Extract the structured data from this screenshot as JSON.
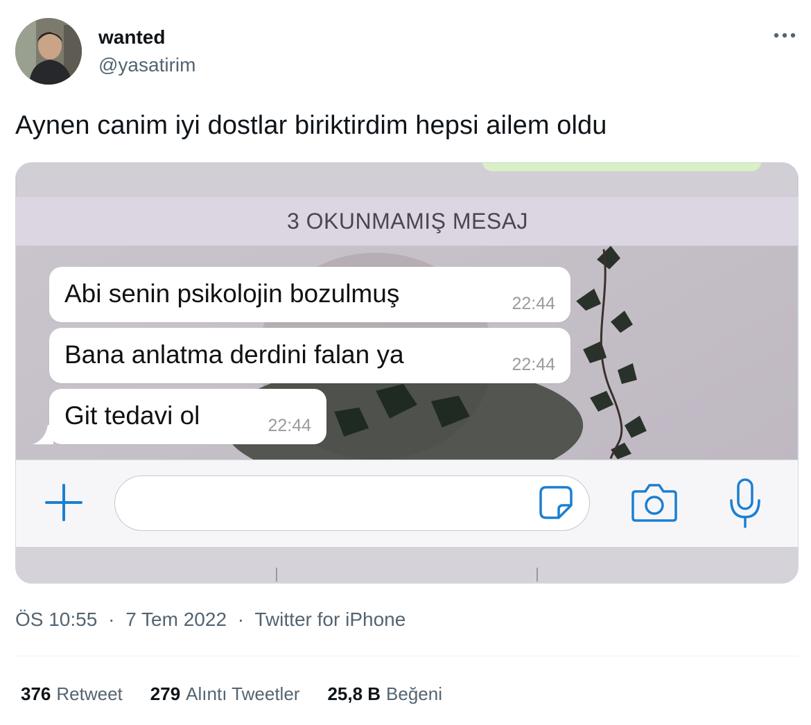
{
  "tweet": {
    "author_name": "wanted",
    "author_handle": "@yasatirim",
    "text": "Aynen canim iyi dostlar biriktirdim hepsi ailem oldu",
    "time": "ÖS 10:55",
    "date": "7 Tem 2022",
    "source": "Twitter for iPhone",
    "separator": "·",
    "more_icon": "more-horizontal-icon"
  },
  "chat": {
    "unread_label": "3 OKUNMAMIŞ MESAJ",
    "messages": [
      {
        "text": "Abi senin psikolojin bozulmuş",
        "time": "22:44"
      },
      {
        "text": "Bana anlatma derdini falan ya",
        "time": "22:44"
      },
      {
        "text": "Git tedavi ol",
        "time": "22:44"
      }
    ],
    "input_placeholder": "",
    "icons": {
      "add": "plus-icon",
      "sticker": "sticker-icon",
      "camera": "camera-icon",
      "mic": "microphone-icon"
    },
    "accent_color": "#1b7fd1"
  },
  "stats": {
    "retweets_count": "376",
    "retweets_label": "Retweet",
    "quotes_count": "279",
    "quotes_label": "Alıntı Tweetler",
    "likes_count": "25,8 B",
    "likes_label": "Beğeni"
  }
}
